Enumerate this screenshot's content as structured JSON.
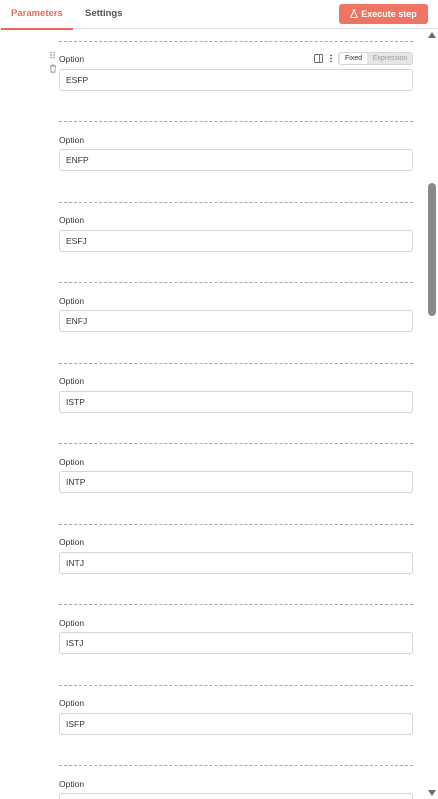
{
  "header": {
    "tabs": [
      {
        "label": "Parameters",
        "active": true
      },
      {
        "label": "Settings",
        "active": false
      }
    ],
    "execute_label": "Execute step",
    "accent_color": "#ea6a57"
  },
  "mode_toggle": {
    "fixed_label": "Fixed",
    "expression_label": "Expression"
  },
  "options": [
    {
      "label": "Option",
      "value": "ESFP"
    },
    {
      "label": "Option",
      "value": "ENFP"
    },
    {
      "label": "Option",
      "value": "ESFJ"
    },
    {
      "label": "Option",
      "value": "ENFJ"
    },
    {
      "label": "Option",
      "value": "ISTP"
    },
    {
      "label": "Option",
      "value": "INTP"
    },
    {
      "label": "Option",
      "value": "INTJ"
    },
    {
      "label": "Option",
      "value": "ISTJ"
    },
    {
      "label": "Option",
      "value": "ISFP"
    },
    {
      "label": "Option",
      "value": ""
    }
  ]
}
